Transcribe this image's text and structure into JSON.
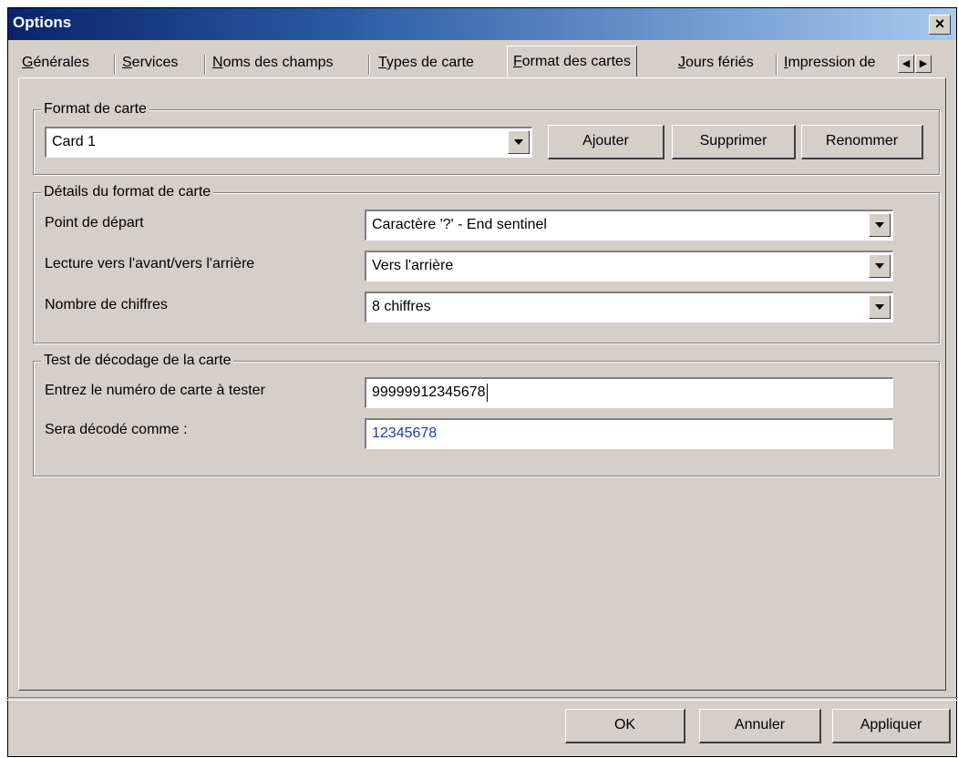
{
  "window": {
    "title": "Options"
  },
  "tabs": [
    {
      "prefix": "",
      "accel": "G",
      "rest": "énérales"
    },
    {
      "prefix": "",
      "accel": "S",
      "rest": "ervices"
    },
    {
      "prefix": "",
      "accel": "N",
      "rest": "oms des champs"
    },
    {
      "prefix": "",
      "accel": "T",
      "rest": "ypes de carte"
    },
    {
      "prefix": "",
      "accel": "F",
      "rest": "ormat des cartes"
    },
    {
      "prefix": "",
      "accel": "J",
      "rest": "ours fériés"
    },
    {
      "prefix": "",
      "accel": "I",
      "rest": "mpression de"
    }
  ],
  "card_format": {
    "legend": "Format de carte",
    "selected": "Card 1",
    "add_label": "Ajouter",
    "delete_label": "Supprimer",
    "rename_label": "Renommer"
  },
  "details": {
    "legend": "Détails du format de carte",
    "start_label": "Point de départ",
    "start_value": "Caractère '?' - End sentinel",
    "direction_label": "Lecture vers l'avant/vers l'arrière",
    "direction_value": "Vers l'arrière",
    "digits_label": "Nombre de chiffres",
    "digits_value": "8 chiffres"
  },
  "test": {
    "legend": "Test de décodage de la carte",
    "input_label": "Entrez le numéro de carte à tester",
    "input_value": "99999912345678",
    "decoded_label": "Sera décodé comme :",
    "decoded_value": "12345678"
  },
  "footer": {
    "ok_label": "OK",
    "cancel_label": "Annuler",
    "apply_label": "Appliquer"
  }
}
